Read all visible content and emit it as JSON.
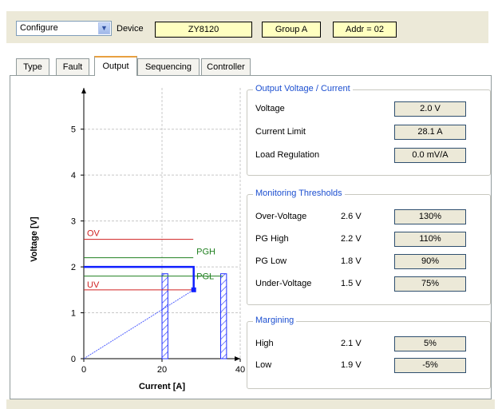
{
  "toolbar": {
    "mode_value": "Configure",
    "device_label": "Device",
    "device_name": "ZY8120",
    "group": "Group A",
    "addr": "Addr = 02"
  },
  "tabs": [
    {
      "label": "Type"
    },
    {
      "label": "Fault"
    },
    {
      "label": "Output",
      "active": true
    },
    {
      "label": "Sequencing"
    },
    {
      "label": "Controller"
    }
  ],
  "output_group": {
    "title": "Output Voltage / Current",
    "rows": [
      {
        "name": "Voltage",
        "value": "2.0 V"
      },
      {
        "name": "Current Limit",
        "value": "28.1 A"
      },
      {
        "name": "Load Regulation",
        "value": "0.0 mV/A"
      }
    ]
  },
  "monitoring_group": {
    "title": "Monitoring Thresholds",
    "rows": [
      {
        "name": "Over-Voltage",
        "threshold": "2.6 V",
        "value": "130%"
      },
      {
        "name": "PG High",
        "threshold": "2.2 V",
        "value": "110%"
      },
      {
        "name": "PG Low",
        "threshold": "1.8 V",
        "value": "90%"
      },
      {
        "name": "Under-Voltage",
        "threshold": "1.5 V",
        "value": "75%"
      }
    ]
  },
  "margining_group": {
    "title": "Margining",
    "rows": [
      {
        "name": "High",
        "threshold": "2.1 V",
        "value": "5%"
      },
      {
        "name": "Low",
        "threshold": "1.9 V",
        "value": "-5%"
      }
    ]
  },
  "colors": {
    "threshold_red": "#d02020",
    "threshold_green": "#208020",
    "output_blue": "#1020ff",
    "group_title_blue": "#1c4fd0",
    "value_box_bg": "#ece9d8",
    "device_box_bg": "#ffffc0"
  },
  "chart_data": {
    "type": "line",
    "xlabel": "Current [A]",
    "ylabel": "Voltage [V]",
    "xlim": [
      0,
      40
    ],
    "ylim": [
      0,
      5.9
    ],
    "x_ticks": [
      "0",
      "20",
      "40"
    ],
    "y_ticks": [
      "0",
      "1",
      "2",
      "3",
      "4",
      "5"
    ],
    "grid": true,
    "threshold_lines": [
      {
        "name": "OV",
        "y": 2.6,
        "color": "#d02020"
      },
      {
        "name": "PGH",
        "y": 2.2,
        "color": "#208020"
      },
      {
        "name": "PGL",
        "y": 1.8,
        "color": "#208020"
      },
      {
        "name": "UV",
        "y": 1.5,
        "color": "#d02020"
      }
    ],
    "output_voltage": 2.0,
    "current_limit": 28.1,
    "hatched_bands": [
      [
        20,
        21.5
      ],
      [
        35,
        36.5
      ]
    ]
  }
}
